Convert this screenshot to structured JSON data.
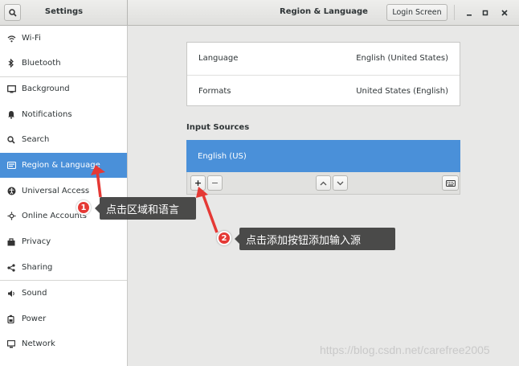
{
  "header": {
    "sidebar_title": "Settings",
    "main_title": "Region & Language",
    "login_button": "Login Screen",
    "window_controls": [
      "minimize-icon",
      "maximize-icon",
      "close-icon"
    ]
  },
  "sidebar": {
    "items": [
      {
        "label": "Wi-Fi",
        "icon": "wifi-icon"
      },
      {
        "label": "Bluetooth",
        "icon": "bluetooth-icon"
      },
      {
        "label": "Background",
        "icon": "background-icon"
      },
      {
        "label": "Notifications",
        "icon": "bell-icon"
      },
      {
        "label": "Search",
        "icon": "search-icon"
      },
      {
        "label": "Region & Language",
        "icon": "region-flag-icon",
        "active": true
      },
      {
        "label": "Universal Access",
        "icon": "accessibility-icon"
      },
      {
        "label": "Online Accounts",
        "icon": "online-accounts-icon"
      },
      {
        "label": "Privacy",
        "icon": "privacy-icon"
      },
      {
        "label": "Sharing",
        "icon": "share-icon"
      },
      {
        "label": "Sound",
        "icon": "speaker-icon"
      },
      {
        "label": "Power",
        "icon": "power-icon"
      },
      {
        "label": "Network",
        "icon": "network-icon"
      }
    ]
  },
  "settings": {
    "language_label": "Language",
    "language_value": "English (United States)",
    "formats_label": "Formats",
    "formats_value": "United States (English)"
  },
  "input_sources": {
    "title": "Input Sources",
    "items": [
      "English (US)"
    ],
    "add_label": "+",
    "remove_label": "−"
  },
  "annotations": {
    "step1_number": "1",
    "step1_text": "点击区域和语言",
    "step2_number": "2",
    "step2_text": "点击添加按钮添加输入源"
  },
  "watermark": "https://blog.csdn.net/carefree2005",
  "colors": {
    "accent": "#4a90d9",
    "annotation_red": "#e53935",
    "callout_bg": "#3c3c3c"
  }
}
